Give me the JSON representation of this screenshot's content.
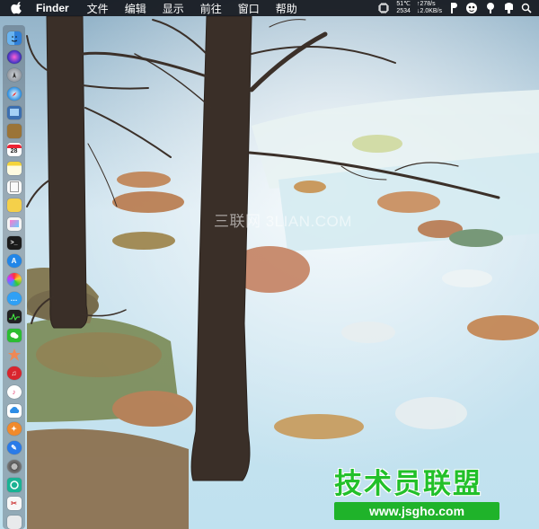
{
  "menubar": {
    "app_name": "Finder",
    "menus": [
      "文件",
      "编辑",
      "显示",
      "前往",
      "窗口",
      "帮助"
    ],
    "status": {
      "temperature": "51℃",
      "fan_speed": "2534",
      "net_up": "↑278/s",
      "net_down": "↓2.0KB/s",
      "icons": [
        "lightbulb-icon",
        "paw-icon",
        "cat-face-icon",
        "lightbulb-small-icon",
        "search-icon"
      ]
    }
  },
  "dock": {
    "apps": [
      "finder-icon",
      "siri-icon",
      "launchpad-icon",
      "safari-icon",
      "preview-icon",
      "notes-book-icon",
      "calendar-icon",
      "notes-icon",
      "text-icon",
      "sticky-icon",
      "photos-icon",
      "terminal-icon",
      "appstore-icon",
      "colorsync-icon",
      "messages-icon",
      "activity-monitor-icon",
      "wechat-icon",
      "game-icon",
      "netease-music-icon",
      "itunes-icon",
      "baidu-cloud-icon",
      "app-orange-icon",
      "xcode-icon",
      "system-preferences-icon",
      "qq-icon",
      "tools-icon",
      "trash-icon"
    ],
    "calendar_day": "28"
  },
  "watermarks": {
    "site_3lian": "三联网 3LIAN.COM",
    "brand_name": "技术员联盟",
    "brand_url": "www.jsgho.com"
  },
  "colors": {
    "menubar_bg": "#12161c",
    "brand_green": "#1fb32a"
  }
}
